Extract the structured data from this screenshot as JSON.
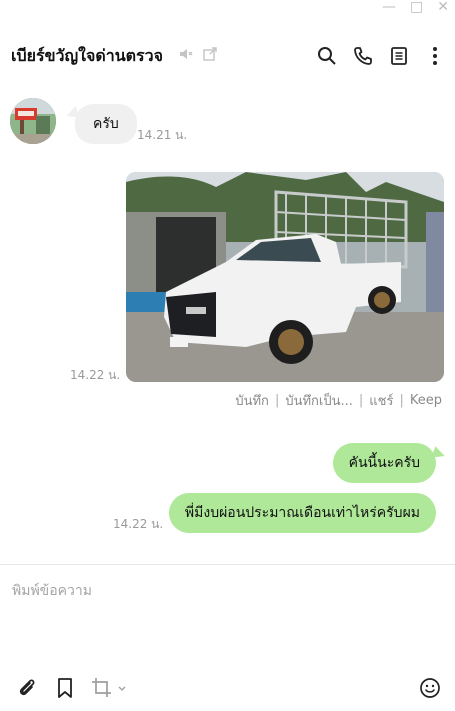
{
  "window": {
    "minimize_icon": "minimize-icon",
    "maximize_icon": "maximize-icon",
    "close_icon": "close-icon"
  },
  "header": {
    "title": "เบียร์ขวัญใจด่านตรวจ",
    "icons": [
      "mute-icon",
      "external-link-icon"
    ],
    "actions": [
      "search-icon",
      "phone-icon",
      "notes-icon",
      "more-icon"
    ]
  },
  "messages": {
    "incoming_text": "ครับ",
    "incoming_time": "14.21 น.",
    "photo_time": "14.22 น.",
    "photo_actions": [
      "บันทึก",
      "บันทึกเป็น...",
      "แชร์",
      "Keep"
    ],
    "outgoing_1": "คันนี้นะครับ",
    "outgoing_2": "พี่มีงบผ่อนประมาณเดือนเท่าไหร่ครับผม",
    "outgoing_time": "14.22 น."
  },
  "composer": {
    "placeholder": "พิมพ์ข้อความ"
  },
  "toolbar": {
    "icons": [
      "attach-icon",
      "bookmark-icon",
      "crop-icon",
      "emoji-icon"
    ]
  },
  "colors": {
    "bubble_out": "#aee898",
    "bubble_in": "#f0f0f0",
    "time": "#9a9a9a"
  }
}
